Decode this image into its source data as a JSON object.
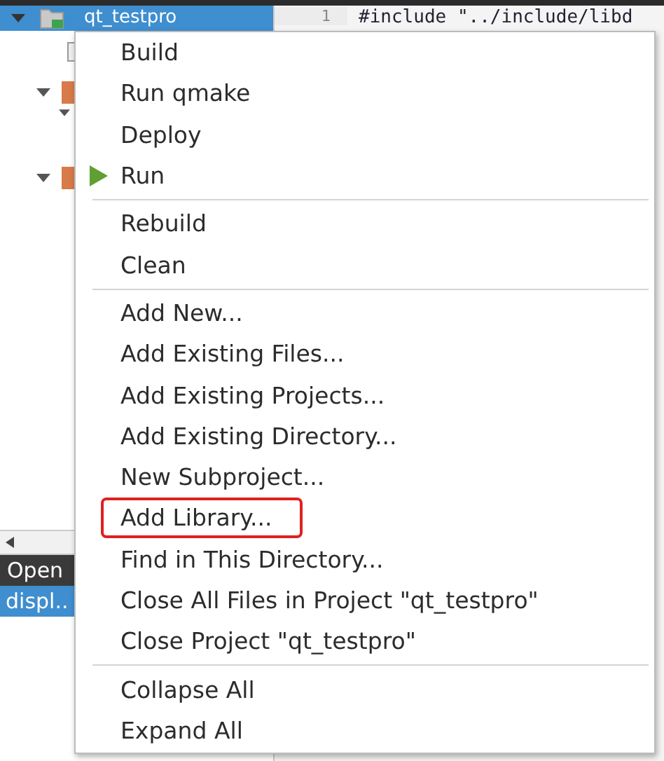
{
  "project_tree": {
    "root": {
      "label": "qt_testpro",
      "selected": true
    }
  },
  "editor": {
    "line_number": "1",
    "code": "#include \"../include/libd"
  },
  "open_documents": {
    "title": "Open",
    "items": [
      {
        "label": "displ..",
        "selected": true
      }
    ]
  },
  "context_menu": {
    "items": [
      {
        "kind": "action",
        "label": "Build",
        "highlighted": false
      },
      {
        "kind": "action",
        "label": "Run qmake",
        "highlighted": false
      },
      {
        "kind": "action",
        "label": "Deploy",
        "highlighted": false
      },
      {
        "kind": "run",
        "label": "Run",
        "highlighted": false
      },
      {
        "kind": "separator"
      },
      {
        "kind": "action",
        "label": "Rebuild",
        "highlighted": false
      },
      {
        "kind": "action",
        "label": "Clean",
        "highlighted": false
      },
      {
        "kind": "separator"
      },
      {
        "kind": "action",
        "label": "Add New...",
        "highlighted": false
      },
      {
        "kind": "action",
        "label": "Add Existing Files...",
        "highlighted": false
      },
      {
        "kind": "action",
        "label": "Add Existing Projects...",
        "highlighted": false
      },
      {
        "kind": "action",
        "label": "Add Existing Directory...",
        "highlighted": false
      },
      {
        "kind": "action",
        "label": "New Subproject...",
        "highlighted": false
      },
      {
        "kind": "action",
        "label": "Add Library...",
        "highlighted": true
      },
      {
        "kind": "action",
        "label": "Find in This Directory...",
        "highlighted": false
      },
      {
        "kind": "action",
        "label": "Close All Files in Project \"qt_testpro\"",
        "highlighted": false
      },
      {
        "kind": "action",
        "label": "Close Project \"qt_testpro\"",
        "highlighted": false
      },
      {
        "kind": "separator"
      },
      {
        "kind": "action",
        "label": "Collapse All",
        "highlighted": false
      },
      {
        "kind": "action",
        "label": "Expand All",
        "highlighted": false
      }
    ]
  }
}
